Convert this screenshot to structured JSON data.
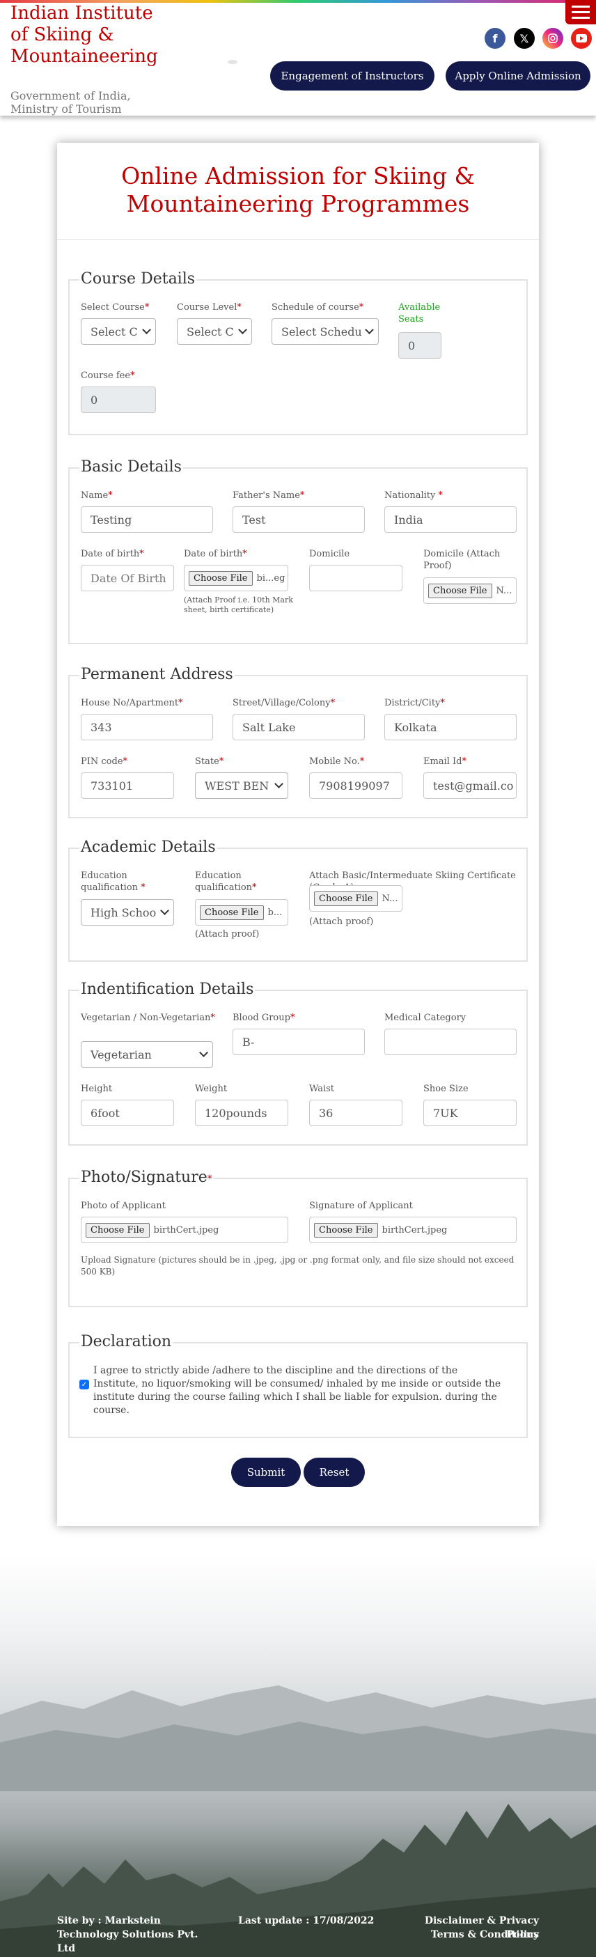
{
  "header": {
    "title": "Indian Institute of Skiing & Mountaineering",
    "subtitle": "Government of India, Ministry of Tourism",
    "nav": {
      "engagement": "Engagement of Instructors",
      "apply": "Apply Online Admission"
    },
    "social": [
      "facebook-icon",
      "x-icon",
      "instagram-icon",
      "youtube-icon"
    ],
    "colors": {
      "brand": "#c00000",
      "navy": "#13194a"
    }
  },
  "form": {
    "title": "Online Admission for Skiing & Mountaineering Programmes",
    "course": {
      "legend": "Course Details",
      "select_course_label": "Select Course",
      "select_course_value": "Select C",
      "course_level_label": "Course Level",
      "course_level_value": "Select C",
      "schedule_label": "Schedule of course",
      "schedule_value": "Select Schedu",
      "available_label": "Available Seats",
      "available_value": "0",
      "fee_label": "Course fee",
      "fee_value": "0"
    },
    "basic": {
      "legend": "Basic Details",
      "name_label": "Name",
      "name_value": "Testing",
      "father_label": "Father's Name",
      "father_value": "Test",
      "nationality_label": "Nationality ",
      "nationality_value": "India",
      "dob_label": "Date of birth",
      "dob_placeholder": "Date Of Birth",
      "dob_file_label": "Date of birth",
      "dob_file_name": "bi...eg",
      "dob_note": "(Attach Proof i.e. 10th Mark sheet, birth certificate)",
      "domicile_label": "Domicile",
      "domicile_value": "",
      "domicile_proof_label": "Domicile (Attach Proof)",
      "domicile_file_name": "N...",
      "choose_file": "Choose File"
    },
    "address": {
      "legend": "Permanent Address",
      "house_label": "House No/Apartment",
      "house_value": "343",
      "street_label": "Street/Village/Colony",
      "street_value": "Salt Lake",
      "district_label": "District/City",
      "district_value": "Kolkata",
      "pin_label": "PIN code",
      "pin_value": "733101",
      "state_label": "State",
      "state_value": "WEST BEN",
      "mobile_label": "Mobile No.",
      "mobile_value": "7908199097",
      "email_label": "Email Id",
      "email_value": "test@gmail.co"
    },
    "academic": {
      "legend": "Academic Details",
      "edu_label": "Education qualification ",
      "edu_value": "High Schoo",
      "edu_file_label": "Education qualification",
      "edu_file_name": "b...",
      "edu_note": "(Attach proof)",
      "cert_label": "Attach Basic/Intermeduate Skiing Certificate (Grade-A)",
      "cert_file_name": "N...",
      "cert_note": "(Attach proof)"
    },
    "identification": {
      "legend": "Indentification Details",
      "veg_label": "Vegetarian / Non-Vegetarian",
      "veg_value": "Vegetarian",
      "blood_label": "Blood Group",
      "blood_value": "B-",
      "medical_label": "Medical Category",
      "medical_value": "",
      "height_label": "Height",
      "height_value": "6foot",
      "weight_label": "Weight",
      "weight_value": "120pounds",
      "waist_label": "Waist",
      "waist_value": "36",
      "shoe_label": "Shoe Size",
      "shoe_value": "7UK"
    },
    "photo": {
      "legend": "Photo/Signature",
      "photo_label": "Photo of Applicant",
      "photo_file": "birthCert.jpeg",
      "sign_label": "Signature of Applicant",
      "sign_file": "birthCert.jpeg",
      "note": "Upload Signature (pictures should be in .jpeg, .jpg or .png format only, and file size should not exceed 500 KB)"
    },
    "declaration": {
      "legend": "Declaration",
      "text": "I agree to strictly abide /adhere to the discipline and the directions of the Institute, no liquor/smoking will be consumed/ inhaled by me inside or outside the institute during the course failing which I shall be liable for expulsion. during the course.",
      "checked": true
    },
    "buttons": {
      "submit": "Submit",
      "reset": "Reset"
    },
    "required_mark": "*"
  },
  "footer": {
    "site_by": "Site by : Markstein Technology Solutions Pvt. Ltd",
    "last_update": "Last update : 17/08/2022",
    "disclaimer": "Disclaimer & Privacy Policy",
    "terms": "Terms & Conditions"
  }
}
